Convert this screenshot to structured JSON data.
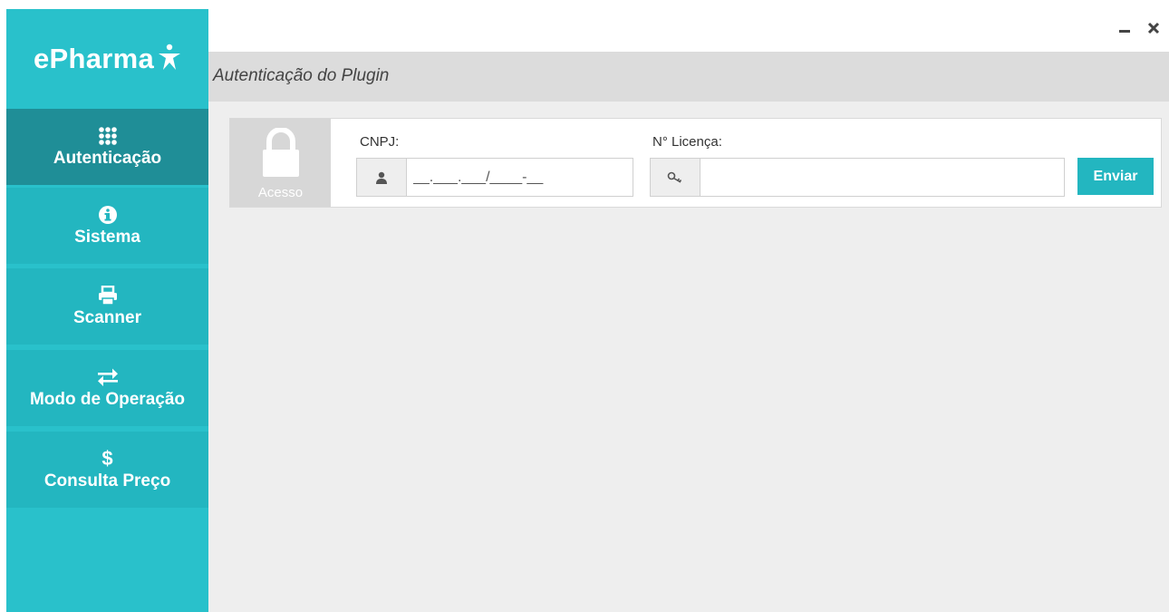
{
  "app": {
    "logo_text": "ePharma"
  },
  "sidebar": {
    "items": [
      {
        "label": "Autenticação",
        "icon": "grid-icon"
      },
      {
        "label": "Sistema",
        "icon": "info-icon"
      },
      {
        "label": "Scanner",
        "icon": "printer-icon"
      },
      {
        "label": "Modo de Operação",
        "icon": "exchange-icon"
      },
      {
        "label": "Consulta Preço",
        "icon": "dollar-icon"
      }
    ],
    "active_index": 0
  },
  "header": {
    "title": "Autenticação do Plugin"
  },
  "auth_panel": {
    "lock_label": "Acesso",
    "cnpj_label": "CNPJ:",
    "cnpj_value": "__.___.___/____-__",
    "license_label": "N° Licença:",
    "license_value": "",
    "send_label": "Enviar"
  },
  "colors": {
    "accent": "#29c1cb",
    "nav_bg": "#23b6c0",
    "nav_active": "#1f8e97"
  }
}
